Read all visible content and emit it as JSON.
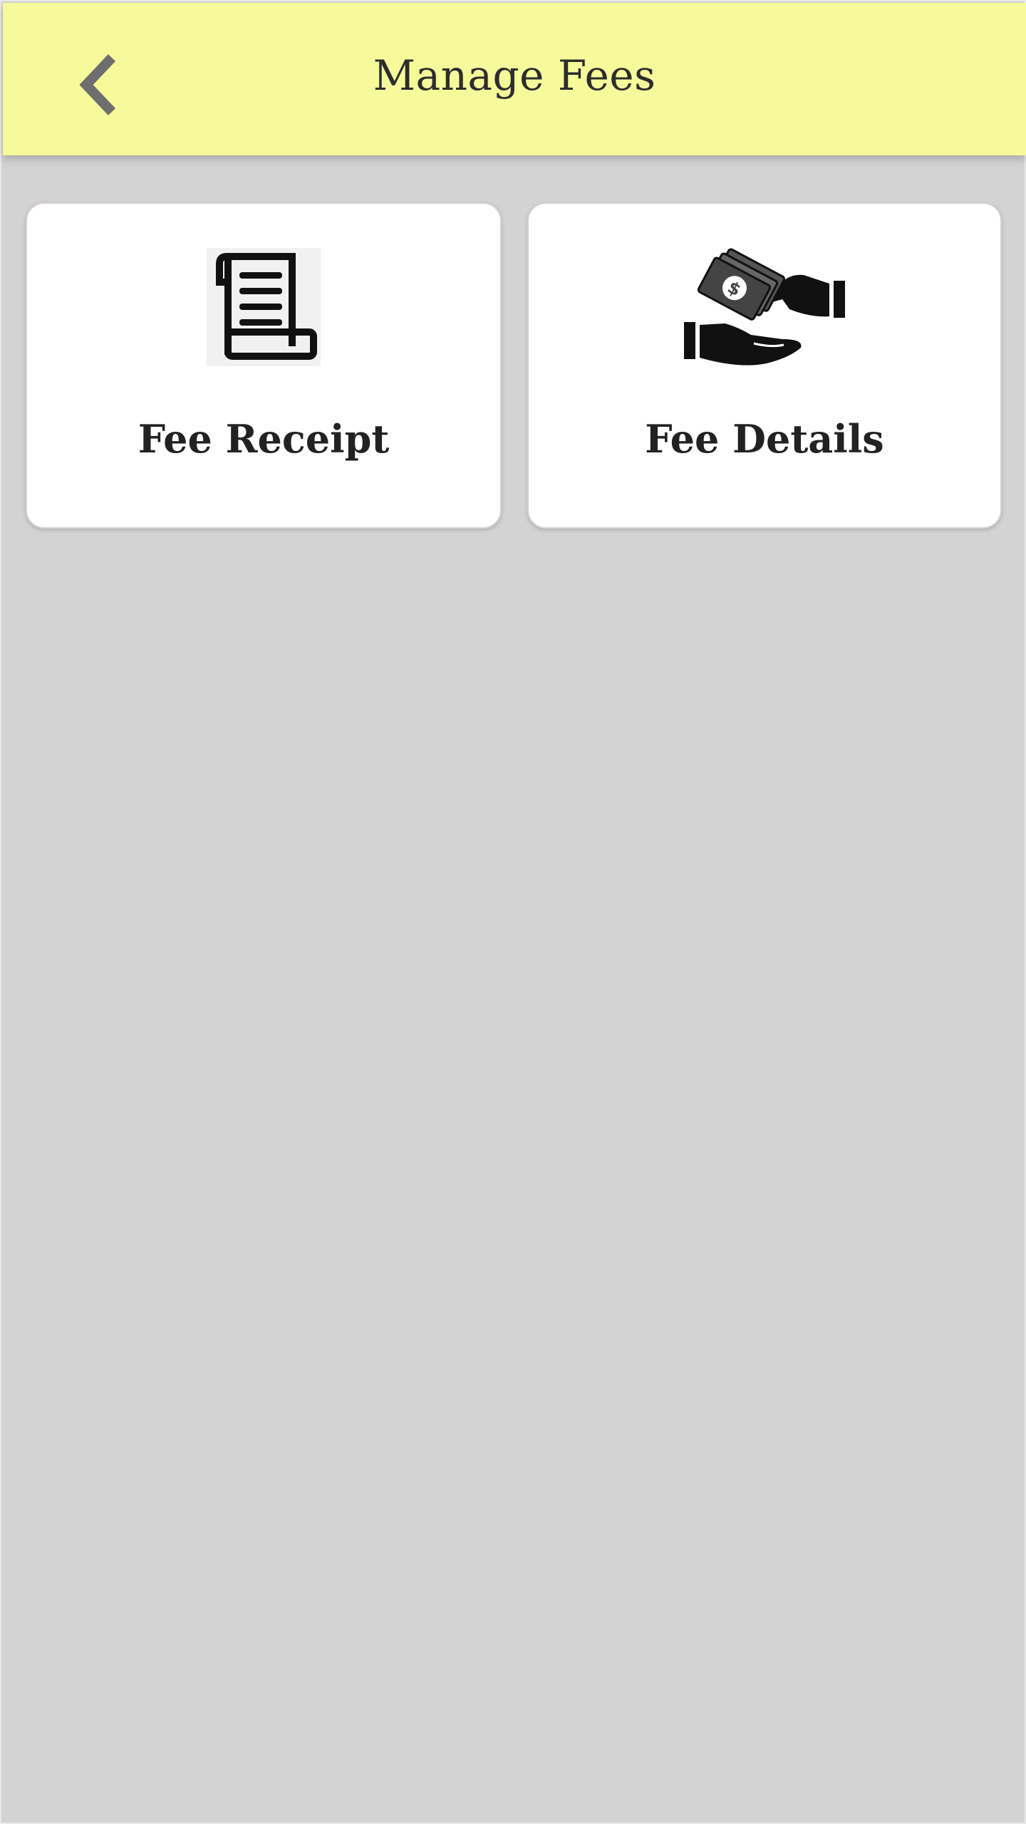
{
  "header": {
    "title": "Manage Fees",
    "back_icon": "chevron-left-icon",
    "background_color": "#f7fa9a"
  },
  "cards": [
    {
      "label": "Fee Receipt",
      "icon": "receipt-scroll-icon"
    },
    {
      "label": "Fee Details",
      "icon": "money-handover-icon"
    }
  ],
  "colors": {
    "page_background": "#d3d3d3",
    "card_background": "#ffffff",
    "text": "#222222"
  }
}
